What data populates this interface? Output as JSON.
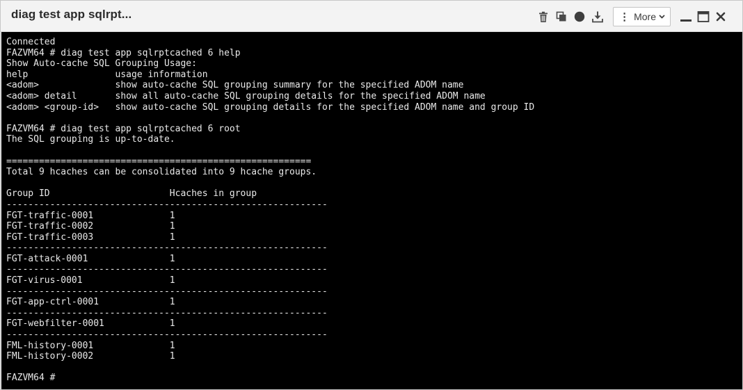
{
  "window": {
    "title": "diag test app sqlrpt..."
  },
  "toolbar": {
    "delete_icon": "trash-icon",
    "copy_icon": "copy-icon",
    "record_icon": "circle-icon",
    "download_icon": "download-icon",
    "more_dots": "⋮",
    "more_label": "More",
    "more_chevron": "⌄",
    "minimize_icon": "minimize-icon",
    "maximize_icon": "maximize-icon",
    "close_icon": "close-icon"
  },
  "terminal": {
    "lines": [
      "Connected",
      "FAZVM64 # diag test app sqlrptcached 6 help",
      "Show Auto-cache SQL Grouping Usage:",
      "help                usage information",
      "<adom>              show auto-cache SQL grouping summary for the specified ADOM name",
      "<adom> detail       show all auto-cache SQL grouping details for the specified ADOM name",
      "<adom> <group-id>   show auto-cache SQL grouping details for the specified ADOM name and group ID",
      "",
      "FAZVM64 # diag test app sqlrptcached 6 root",
      "The SQL grouping is up-to-date.",
      "",
      "========================================================",
      "Total 9 hcaches can be consolidated into 9 hcache groups.",
      "",
      "Group ID                      Hcaches in group",
      "-----------------------------------------------------------",
      "FGT-traffic-0001              1",
      "FGT-traffic-0002              1",
      "FGT-traffic-0003              1",
      "-----------------------------------------------------------",
      "FGT-attack-0001               1",
      "-----------------------------------------------------------",
      "FGT-virus-0001                1",
      "-----------------------------------------------------------",
      "FGT-app-ctrl-0001             1",
      "-----------------------------------------------------------",
      "FGT-webfilter-0001            1",
      "-----------------------------------------------------------",
      "FML-history-0001              1",
      "FML-history-0002              1",
      "",
      "FAZVM64 #"
    ]
  },
  "colors": {
    "terminal_bg": "#000000",
    "terminal_fg": "#e9e9e9",
    "titlebar_bg": "#f3f3f3"
  }
}
